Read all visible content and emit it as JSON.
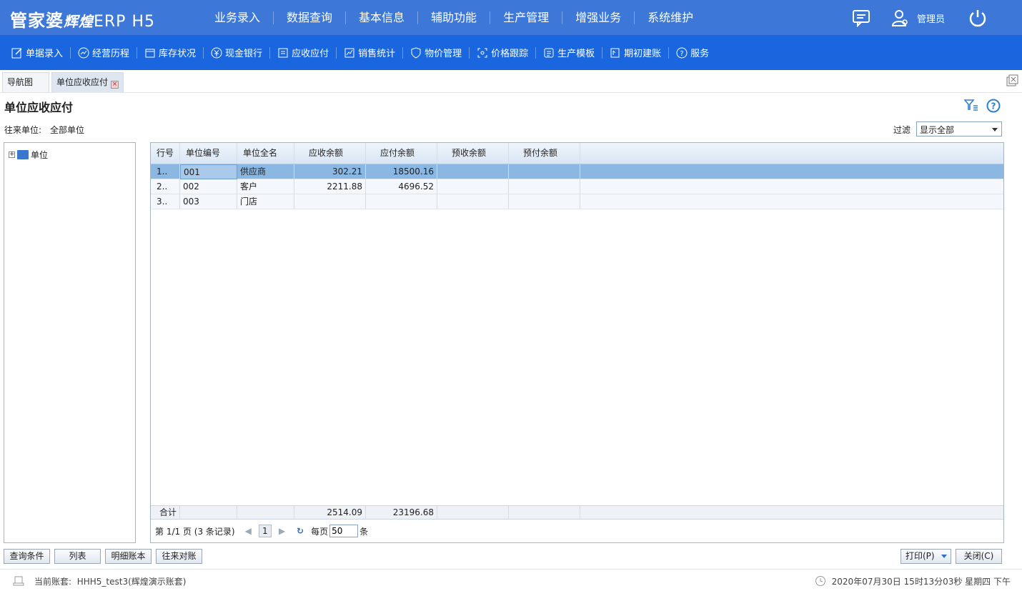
{
  "header": {
    "logo_main": "管家婆",
    "logo_sub": "辉煌",
    "logo_suffix": "ERP H5",
    "nav": [
      "业务录入",
      "数据查询",
      "基本信息",
      "辅助功能",
      "生产管理",
      "增强业务",
      "系统维护"
    ],
    "user": "管理员"
  },
  "toolbar": [
    {
      "label": "单据录入",
      "icon": "edit-icon"
    },
    {
      "label": "经营历程",
      "icon": "trend-icon"
    },
    {
      "label": "库存状况",
      "icon": "store-icon"
    },
    {
      "label": "现金银行",
      "icon": "yuan-icon"
    },
    {
      "label": "应收应付",
      "icon": "ledger-icon"
    },
    {
      "label": "销售统计",
      "icon": "stats-icon"
    },
    {
      "label": "物价管理",
      "icon": "shield-icon"
    },
    {
      "label": "价格跟踪",
      "icon": "track-icon"
    },
    {
      "label": "生产模板",
      "icon": "template-icon"
    },
    {
      "label": "期初建账",
      "icon": "opening-icon"
    },
    {
      "label": "服务",
      "icon": "help-circle-icon"
    }
  ],
  "tabs": {
    "nav": "导航图",
    "active": "单位应收应付"
  },
  "page": {
    "title": "单位应收应付",
    "unit_label": "往来单位:",
    "unit_value": "全部单位",
    "filter_label": "过滤",
    "filter_value": "显示全部"
  },
  "tree": {
    "root": "单位"
  },
  "table": {
    "headers": [
      "行号",
      "单位编号",
      "单位全名",
      "应收余额",
      "应付余额",
      "预收余额",
      "预付余额"
    ],
    "rows": [
      [
        "1..",
        "001",
        "供应商",
        "302.21",
        "18500.16",
        "",
        ""
      ],
      [
        "2..",
        "002",
        "客户",
        "2211.88",
        "4696.52",
        "",
        ""
      ],
      [
        "3..",
        "003",
        "门店",
        "",
        "",
        "",
        ""
      ]
    ],
    "total": [
      "合计",
      "",
      "",
      "2514.09",
      "23196.68",
      "",
      ""
    ]
  },
  "pager": {
    "summary": "第 1/1 页 (3 条记录)",
    "current": "1",
    "per_page_label": "每页",
    "per_page": "50",
    "unit": "条"
  },
  "buttons": {
    "query": "查询条件",
    "list": "列表",
    "detail": "明细账本",
    "reconcile": "往来对账",
    "print": "打印(P)",
    "close": "关闭(C)"
  },
  "status": {
    "account_label": "当前账套:",
    "account": "HHH5_test3(辉煌演示账套)",
    "time": "2020年07月30日 15时13分03秒 星期四 下午"
  }
}
